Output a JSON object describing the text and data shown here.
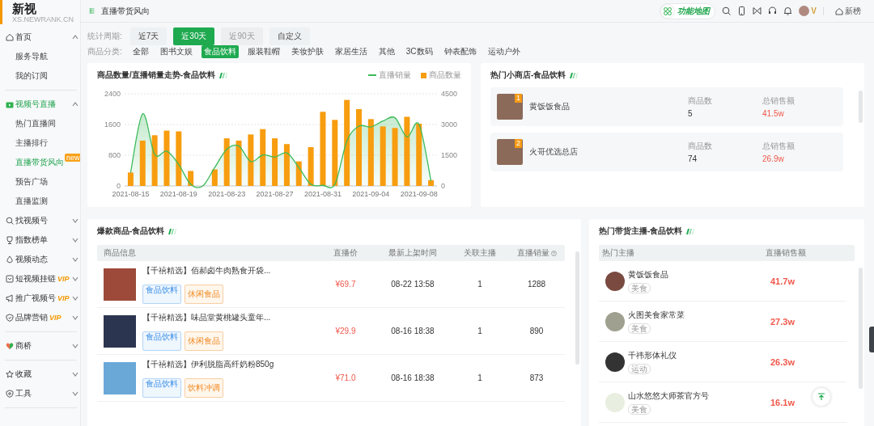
{
  "logo": {
    "title": "新视",
    "subtitle": "XS.NEWRANK.CN"
  },
  "breadcrumb": "直播带货风向",
  "header": {
    "feature_map": "功能地图",
    "vip_mark": "V",
    "home_link": "新榜"
  },
  "sidebar": {
    "items": [
      {
        "label": "首页",
        "expanded": true,
        "selected": false,
        "children": [
          {
            "label": "服务导航",
            "selected": false
          },
          {
            "label": "我的订阅",
            "selected": false
          }
        ]
      },
      {
        "kind": "divider"
      },
      {
        "label": "视频号直播",
        "expanded": true,
        "selected": true,
        "children": [
          {
            "label": "热门直播间",
            "selected": false
          },
          {
            "label": "主播排行",
            "selected": false
          },
          {
            "label": "直播带货风向",
            "selected": true,
            "badge": "new"
          },
          {
            "label": "预告广场",
            "selected": false
          },
          {
            "label": "直播监测",
            "selected": false
          }
        ]
      },
      {
        "label": "找视频号",
        "expanded": false,
        "selected": false
      },
      {
        "label": "指数榜单",
        "expanded": false,
        "selected": false
      },
      {
        "label": "视频动态",
        "expanded": false,
        "selected": false
      },
      {
        "label": "短视频挂链",
        "expanded": false,
        "selected": false,
        "badge": "VIP"
      },
      {
        "label": "推广视频号",
        "expanded": false,
        "selected": false,
        "badge": "VIP"
      },
      {
        "label": "品牌营销",
        "expanded": false,
        "selected": false,
        "badge": "VIP"
      },
      {
        "kind": "divider"
      },
      {
        "label": "商桥",
        "expanded": false,
        "selected": false
      },
      {
        "kind": "divider"
      },
      {
        "label": "收藏",
        "expanded": false,
        "selected": false
      },
      {
        "label": "工具",
        "expanded": false,
        "selected": false
      },
      {
        "kind": "divider"
      }
    ]
  },
  "period_filter": {
    "label": "统计周期:",
    "options": [
      {
        "label": "近7天",
        "selected": false,
        "disabled": false
      },
      {
        "label": "近30天",
        "selected": true,
        "disabled": false
      },
      {
        "label": "近90天",
        "selected": false,
        "disabled": true
      },
      {
        "label": "自定义",
        "selected": false,
        "disabled": false
      }
    ]
  },
  "category_filter": {
    "label": "商品分类:",
    "options": [
      {
        "label": "全部",
        "selected": false
      },
      {
        "label": "图书文娱",
        "selected": false
      },
      {
        "label": "食品饮料",
        "selected": true
      },
      {
        "label": "服装鞋帽",
        "selected": false
      },
      {
        "label": "美妆护肤",
        "selected": false
      },
      {
        "label": "家居生活",
        "selected": false
      },
      {
        "label": "其他",
        "selected": false
      },
      {
        "label": "3C数码",
        "selected": false
      },
      {
        "label": "钟表配饰",
        "selected": false
      },
      {
        "label": "运动户外",
        "selected": false
      }
    ]
  },
  "trend_panel": {
    "title": "商品数量/直播销量走势-食品饮料",
    "chart_data": {
      "type": "bar",
      "categories": [
        "2021-08-15",
        null,
        null,
        null,
        "2021-08-19",
        null,
        null,
        null,
        "2021-08-23",
        null,
        null,
        null,
        "2021-08-27",
        null,
        null,
        null,
        "2021-08-31",
        null,
        null,
        null,
        "2021-09-04",
        null,
        null,
        null,
        "2021-09-08",
        null
      ],
      "series": [
        {
          "name": "直播销量",
          "type": "line",
          "axis": "y2",
          "color": "#3cba5a",
          "values": [
            650,
            3520,
            1540,
            1700,
            1050,
            80,
            0,
            900,
            1790,
            1950,
            1190,
            1510,
            1410,
            1610,
            900,
            80,
            30,
            80,
            2190,
            2920,
            2880,
            3170,
            3330,
            2390,
            3010,
            240
          ]
        },
        {
          "name": "商品数量",
          "type": "bar",
          "color": "#f79d0f",
          "values": [
            350,
            1180,
            1320,
            1440,
            1420,
            390,
            null,
            430,
            1240,
            1180,
            1340,
            1480,
            1240,
            1090,
            640,
            1010,
            1930,
            1720,
            2240,
            2000,
            1740,
            1550,
            1510,
            1800,
            1620,
            150
          ]
        }
      ],
      "ylim": [
        0,
        2400
      ],
      "yticks": [
        0,
        800,
        1600,
        2400
      ],
      "y2lim": [
        0,
        4500
      ],
      "y2ticks": [
        0,
        1500,
        3000,
        4500
      ]
    }
  },
  "shops_panel": {
    "title": "热门小商店-食品饮料",
    "rows": [
      {
        "rank": "1",
        "name": "黄饭饭食品",
        "count_label": "商品数",
        "count": "5",
        "sales_label": "总销售额",
        "sales": "41.5w"
      },
      {
        "rank": "2",
        "name": "火哥优选总店",
        "count_label": "商品数",
        "count": "74",
        "sales_label": "总销售额",
        "sales": "26.9w"
      }
    ]
  },
  "products_panel": {
    "title": "爆款商品-食品饮料",
    "columns": [
      "商品信息",
      "直播价",
      "最新上架时间",
      "关联主播",
      "直播销量"
    ],
    "rows": [
      {
        "title": "【千禧精选】佰郝卤牛肉熟食开袋...",
        "tags": [
          {
            "label": "食品饮料",
            "kind": "category"
          },
          {
            "label": "休闲食品",
            "kind": "sub"
          }
        ],
        "price": "¥69.7",
        "time": "08-22 13:58",
        "hosts": "1",
        "sales": "1288"
      },
      {
        "title": "【千禧精选】味品堂黄桃罐头童年...",
        "tags": [
          {
            "label": "食品饮料",
            "kind": "category"
          },
          {
            "label": "休闲食品",
            "kind": "sub"
          }
        ],
        "price": "¥29.9",
        "time": "08-16 18:38",
        "hosts": "1",
        "sales": "890"
      },
      {
        "title": "【千禧精选】伊利脱脂高纤奶粉850g",
        "tags": [
          {
            "label": "食品饮料",
            "kind": "category"
          },
          {
            "label": "饮料冲调",
            "kind": "sub"
          }
        ],
        "price": "¥71.0",
        "time": "08-16 18:38",
        "hosts": "1",
        "sales": "873"
      }
    ]
  },
  "hosts_panel": {
    "title": "热门带货主播-食品饮料",
    "columns": [
      "热门主播",
      "直播销售额"
    ],
    "rows": [
      {
        "name": "黄饭饭食品",
        "tag": "美食",
        "sales": "41.7w"
      },
      {
        "name": "火图美食家常菜",
        "tag": "美食",
        "sales": "27.3w"
      },
      {
        "name": "千祎形体礼仪",
        "tag": "运动",
        "sales": "26.3w"
      },
      {
        "name": "山水悠悠大师茶官方号",
        "tag": "美食",
        "sales": "16.1w"
      }
    ]
  }
}
